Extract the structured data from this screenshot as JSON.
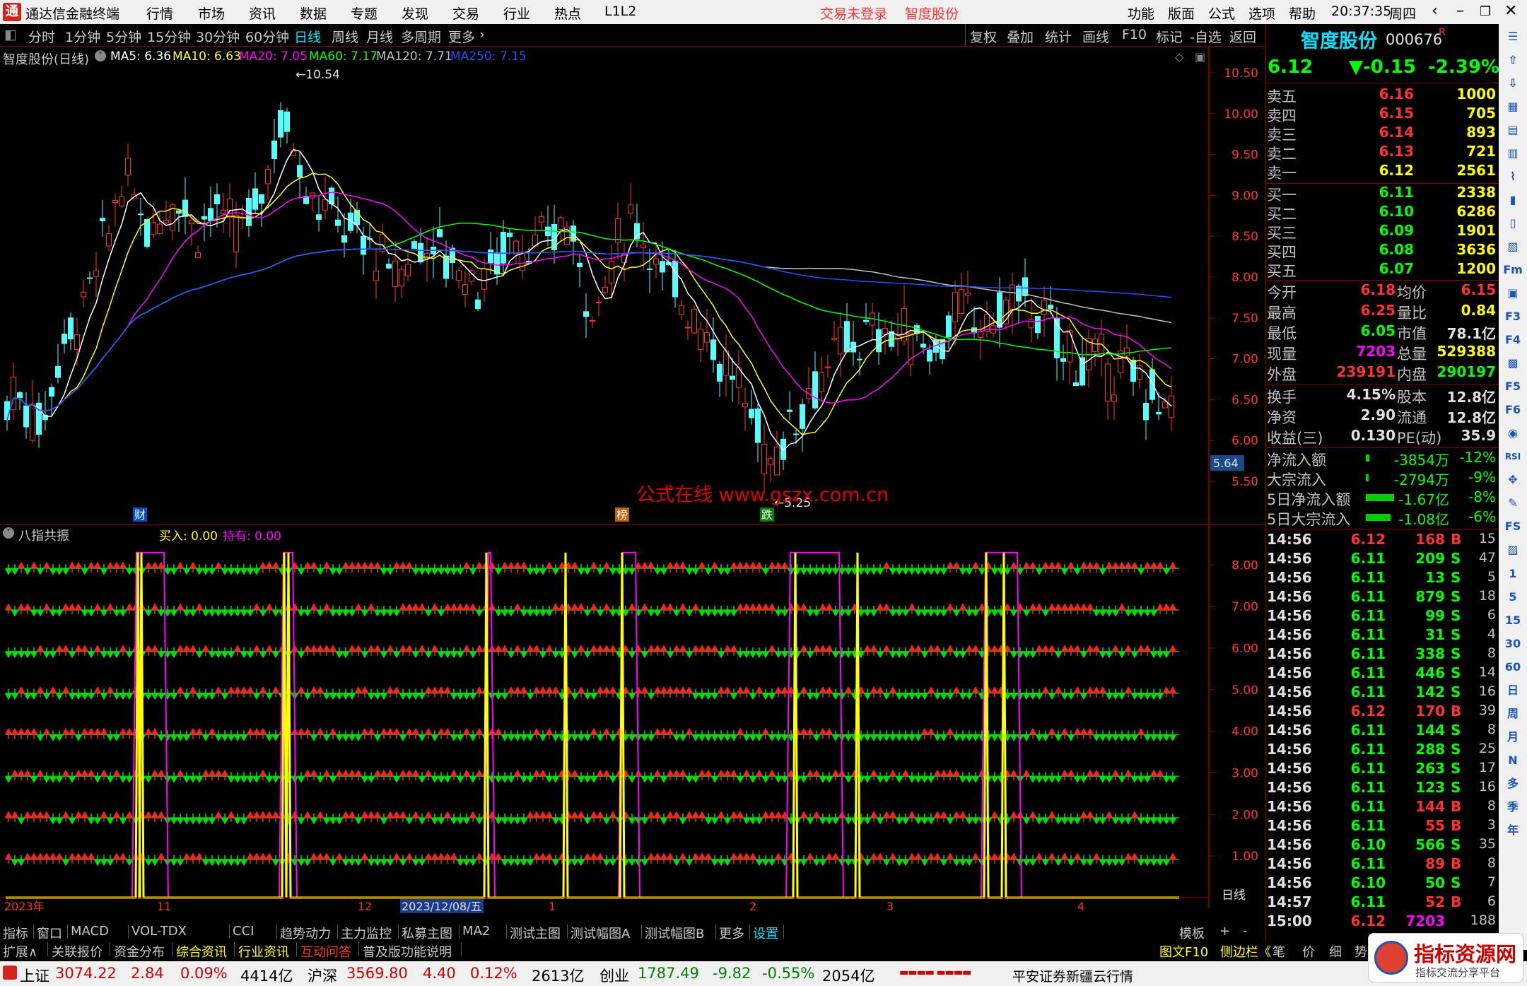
{
  "window": {
    "title": "通达信金融终端",
    "menus": [
      "行情",
      "市场",
      "资讯",
      "数据",
      "专题",
      "发现",
      "交易",
      "行业",
      "热点",
      "L1L2"
    ],
    "login_status": "交易未登录",
    "stock_link": "智度股份",
    "right_menus": [
      "功能",
      "版面",
      "公式",
      "选项",
      "帮助"
    ],
    "time": "20:37:35",
    "weekday": "周四"
  },
  "toolbar": {
    "periods": [
      "分时",
      "1分钟",
      "5分钟",
      "15分钟",
      "30分钟",
      "60分钟",
      "日线",
      "周线",
      "月线",
      "多周期",
      "更多"
    ],
    "selected_period": "日线",
    "actions": [
      "复权",
      "叠加",
      "统计",
      "画线",
      "F10",
      "标记",
      "-自选",
      "返回"
    ]
  },
  "main_chart": {
    "title": "智度股份(日线)",
    "ma_labels": [
      {
        "text": "MA5: 6.36",
        "color": "#ffffff"
      },
      {
        "text": "MA10: 6.63",
        "color": "#ffff00"
      },
      {
        "text": "MA20: 7.05",
        "color": "#ff00ff"
      },
      {
        "text": "MA60: 7.17",
        "color": "#00ff00"
      },
      {
        "text": "MA120: 7.71",
        "color": "#c0c0c0"
      },
      {
        "text": "MA250: 7.15",
        "color": "#2050ff"
      }
    ],
    "high_marker": "10.54",
    "low_marker": "5.25",
    "current_price_tag": "5.64",
    "price_axis": [
      "10.50",
      "10.00",
      "9.50",
      "9.00",
      "8.50",
      "8.00",
      "7.50",
      "7.00",
      "6.50",
      "6.00",
      "5.50"
    ],
    "event_markers": [
      "财",
      "榜",
      "跌"
    ],
    "watermark": "公式在线  www.gszx.com.cn"
  },
  "indicator": {
    "name": "八指共振",
    "buy_label": "买入: 0.00",
    "hold_label": "持有: 0.00",
    "axis": [
      "8.00",
      "7.00",
      "6.00",
      "5.00",
      "4.00",
      "3.00",
      "2.00",
      "1.00"
    ],
    "period_label": "日线"
  },
  "time_axis": [
    "2023年",
    "11",
    "12",
    "2023/12/08/五",
    "1",
    "2",
    "3",
    "4"
  ],
  "quote": {
    "name": "智度股份",
    "code": "000676",
    "badge": "R",
    "price": "6.12",
    "change": "▼-0.15",
    "change_pct": "-2.39%",
    "asks": [
      {
        "label": "卖五",
        "price": "6.16",
        "vol": "1000"
      },
      {
        "label": "卖四",
        "price": "6.15",
        "vol": "705"
      },
      {
        "label": "卖三",
        "price": "6.14",
        "vol": "893"
      },
      {
        "label": "卖二",
        "price": "6.13",
        "vol": "721"
      },
      {
        "label": "卖一",
        "price": "6.12",
        "vol": "2561"
      }
    ],
    "bids": [
      {
        "label": "买一",
        "price": "6.11",
        "vol": "2338"
      },
      {
        "label": "买二",
        "price": "6.10",
        "vol": "6286"
      },
      {
        "label": "买三",
        "price": "6.09",
        "vol": "1901"
      },
      {
        "label": "买四",
        "price": "6.08",
        "vol": "3636"
      },
      {
        "label": "买五",
        "price": "6.07",
        "vol": "1200"
      }
    ],
    "stats1": [
      {
        "l1": "今开",
        "v1": "6.18",
        "l2": "均价",
        "v2": "6.15",
        "c1": "#ff3232",
        "c2": "#ff3232"
      },
      {
        "l1": "最高",
        "v1": "6.25",
        "l2": "量比",
        "v2": "0.84",
        "c1": "#ff3232",
        "c2": "#ffff00"
      },
      {
        "l1": "最低",
        "v1": "6.05",
        "l2": "市值",
        "v2": "78.1亿",
        "c1": "#00ff00",
        "c2": "#e0e0e0"
      },
      {
        "l1": "现量",
        "v1": "7203",
        "l2": "总量",
        "v2": "529388",
        "c1": "#ff00ff",
        "c2": "#ffff00"
      },
      {
        "l1": "外盘",
        "v1": "239191",
        "l2": "内盘",
        "v2": "290197",
        "c1": "#ff3232",
        "c2": "#00ff00"
      }
    ],
    "stats2": [
      {
        "l1": "换手",
        "v1": "4.15%",
        "l2": "股本",
        "v2": "12.8亿",
        "c1": "#e0e0e0",
        "c2": "#e0e0e0"
      },
      {
        "l1": "净资",
        "v1": "2.90",
        "l2": "流通",
        "v2": "12.8亿",
        "c1": "#e0e0e0",
        "c2": "#e0e0e0"
      },
      {
        "l1": "收益(三)",
        "v1": "0.130",
        "l2": "PE(动)",
        "v2": "35.9",
        "c1": "#e0e0e0",
        "c2": "#e0e0e0"
      }
    ],
    "flows": [
      {
        "label": "净流入额",
        "value": "-3854万",
        "pct": "-12%",
        "bar": 0.05
      },
      {
        "label": "大宗流入",
        "value": "-2794万",
        "pct": "-9%",
        "bar": 0.04
      },
      {
        "label": "5日净流入额",
        "value": "-1.67亿",
        "pct": "-8%",
        "bar": 0.4
      },
      {
        "label": "5日大宗流入",
        "value": "-1.08亿",
        "pct": "-6%",
        "bar": 0.35
      }
    ],
    "ticks": [
      {
        "t": "14:56",
        "p": "6.12",
        "v": "168",
        "bs": "B",
        "n": "15"
      },
      {
        "t": "14:56",
        "p": "6.11",
        "v": "209",
        "bs": "S",
        "n": "47"
      },
      {
        "t": "14:56",
        "p": "6.11",
        "v": "13",
        "bs": "S",
        "n": "5"
      },
      {
        "t": "14:56",
        "p": "6.11",
        "v": "879",
        "bs": "S",
        "n": "18"
      },
      {
        "t": "14:56",
        "p": "6.11",
        "v": "99",
        "bs": "S",
        "n": "6"
      },
      {
        "t": "14:56",
        "p": "6.11",
        "v": "31",
        "bs": "S",
        "n": "4"
      },
      {
        "t": "14:56",
        "p": "6.11",
        "v": "338",
        "bs": "S",
        "n": "8"
      },
      {
        "t": "14:56",
        "p": "6.11",
        "v": "446",
        "bs": "S",
        "n": "14"
      },
      {
        "t": "14:56",
        "p": "6.11",
        "v": "142",
        "bs": "S",
        "n": "16"
      },
      {
        "t": "14:56",
        "p": "6.12",
        "v": "170",
        "bs": "B",
        "n": "39"
      },
      {
        "t": "14:56",
        "p": "6.11",
        "v": "144",
        "bs": "S",
        "n": "8"
      },
      {
        "t": "14:56",
        "p": "6.11",
        "v": "288",
        "bs": "S",
        "n": "25"
      },
      {
        "t": "14:56",
        "p": "6.11",
        "v": "263",
        "bs": "S",
        "n": "17"
      },
      {
        "t": "14:56",
        "p": "6.11",
        "v": "123",
        "bs": "S",
        "n": "16"
      },
      {
        "t": "14:56",
        "p": "6.11",
        "v": "144",
        "bs": "B",
        "n": "8"
      },
      {
        "t": "14:56",
        "p": "6.11",
        "v": "55",
        "bs": "B",
        "n": "3"
      },
      {
        "t": "14:56",
        "p": "6.10",
        "v": "566",
        "bs": "S",
        "n": "35"
      },
      {
        "t": "14:56",
        "p": "6.11",
        "v": "89",
        "bs": "B",
        "n": "8"
      },
      {
        "t": "14:56",
        "p": "6.10",
        "v": "50",
        "bs": "S",
        "n": "7"
      },
      {
        "t": "14:57",
        "p": "6.11",
        "v": "52",
        "bs": "B",
        "n": "6"
      },
      {
        "t": "15:00",
        "p": "6.12",
        "v": "7203",
        "bs": "",
        "n": "188"
      }
    ]
  },
  "side_icons": [
    "Fm",
    "F3",
    "F4",
    "F5",
    "F6",
    "RSI",
    "日",
    "周",
    "月",
    "N",
    "多",
    "季",
    "年",
    "1",
    "5",
    "15",
    "30",
    "60"
  ],
  "tabs_row1": [
    "指标",
    "窗口",
    "MACD",
    "VOL-TDX",
    "CCI",
    "趋势动力",
    "主力监控",
    "私募主图",
    "MA2",
    "测试主图",
    "测试幅图A",
    "测试幅图B",
    "更多",
    "设置"
  ],
  "tabs_row1_right": [
    "模板",
    "+",
    "-"
  ],
  "tabs_row2": [
    "扩展∧",
    "关联报价",
    "资金分布",
    "综合资讯",
    "行业资讯",
    "互动问答",
    "普及版功能说明"
  ],
  "tabs_row2_right": [
    "图文F10",
    "侧边栏《",
    "笔",
    "价",
    "细",
    "势"
  ],
  "status": {
    "sh_label": "上证",
    "sh_val": "3074.22",
    "sh_chg": "2.84",
    "sh_pct": "0.09%",
    "sh_amt": "4414亿",
    "sz_label": "沪深",
    "sz_val": "3569.80",
    "sz_chg": "4.40",
    "sz_pct": "0.12%",
    "sz_amt": "2613亿",
    "cy_label": "创业",
    "cy_val": "1787.49",
    "cy_chg": "-9.82",
    "cy_pct": "-0.55%",
    "cy_amt": "2054亿",
    "broker": "平安证券新疆云行情"
  },
  "badge": {
    "title": "指标资源网",
    "subtitle": "指标交流分享平台"
  }
}
